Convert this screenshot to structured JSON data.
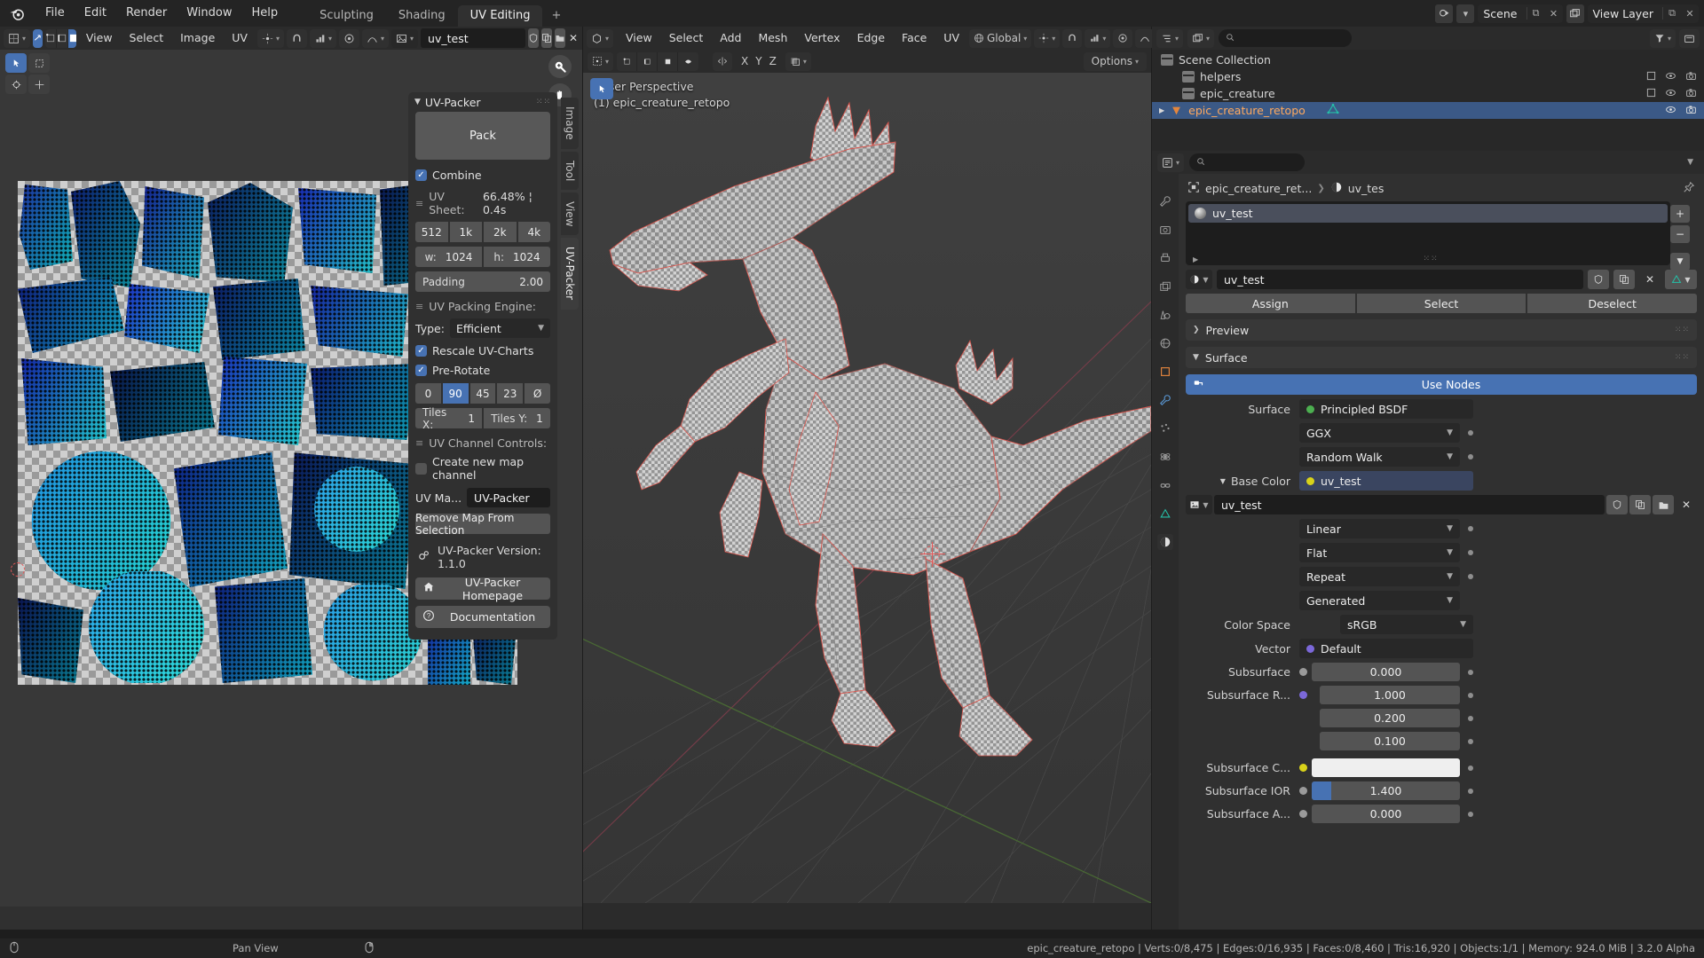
{
  "topbar": {
    "logo_icon": "blender-logo",
    "menus": [
      "File",
      "Edit",
      "Render",
      "Window",
      "Help"
    ],
    "workspaces": [
      {
        "label": "Sculpting",
        "active": false
      },
      {
        "label": "Shading",
        "active": false
      },
      {
        "label": "UV Editing",
        "active": true
      }
    ],
    "add_workspace_label": "+",
    "scene_name": "Scene",
    "view_layer_name": "View Layer",
    "scene_icon": "scene-icon",
    "viewlayer_icon": "images-icon",
    "new_scene_icon": "new-scene-icon",
    "unlink_scene_icon": "unlink-icon",
    "new_viewlayer_icon": "new-layer-icon",
    "remove_viewlayer_icon": "remove-layer-icon"
  },
  "uv_editor": {
    "header": {
      "editor_type_icon": "uv-editor-icon",
      "mode_icon": "uv-sync-icon",
      "select_modes": [
        "vertex-select-icon",
        "edge-select-icon",
        "face-select-icon"
      ],
      "menus": [
        "View",
        "Select",
        "Image",
        "UV"
      ],
      "pivot_icon": "pivot-icon",
      "snap_icon": "magnet-icon",
      "snap_target_icon": "snap-target-icon",
      "proportional_icon": "proportional-edit-icon",
      "falloff_icon": "falloff-icon",
      "image_icon": "image-datablock-icon",
      "image_name": "uv_test",
      "fake_user_icon": "shield-icon",
      "new_image_icon": "duplicate-icon",
      "open_image_icon": "folder-icon",
      "unlink_image_icon": "close-icon"
    },
    "toolbar_tools": [
      "tweak-tool-icon",
      "select-box-icon",
      "cursor-tool-icon",
      "move-tool-icon",
      "rotate-tool-icon",
      "scale-tool-icon"
    ],
    "gizmos": [
      "zoom-gizmo-icon",
      "pan-gizmo-icon"
    ],
    "vertical_tabs": [
      {
        "label": "Image",
        "active": false
      },
      {
        "label": "Tool",
        "active": false
      },
      {
        "label": "View",
        "active": false
      },
      {
        "label": "UV-Packer",
        "active": true
      }
    ]
  },
  "uv_packer": {
    "title": "UV-Packer",
    "collapse_icon": "chevron-down-icon",
    "drag_dots_icon": "grip-dots-icon",
    "pack_button": "Pack",
    "combine": {
      "label": "Combine",
      "checked": true
    },
    "uv_sheet": {
      "label": "UV Sheet:",
      "grip_icon": "grip-icon",
      "status": "66.48% ¦ 0.4s",
      "presets": [
        {
          "label": "512",
          "selected": false
        },
        {
          "label": "1k",
          "selected": false
        },
        {
          "label": "2k",
          "selected": false
        },
        {
          "label": "4k",
          "selected": false
        }
      ],
      "width_label": "w:",
      "width_value": "1024",
      "height_label": "h:",
      "height_value": "1024",
      "padding_label": "Padding",
      "padding_value": "2.00"
    },
    "engine": {
      "label": "UV Packing Engine:",
      "grip_icon": "grip-icon",
      "type_label": "Type:",
      "type_value": "Efficient",
      "type_chevron_icon": "chevron-down-icon",
      "rescale": {
        "label": "Rescale UV-Charts",
        "checked": true
      },
      "prerotate": {
        "label": "Pre-Rotate",
        "checked": true
      },
      "rotation_steps": [
        {
          "label": "0",
          "selected": false
        },
        {
          "label": "90",
          "selected": true
        },
        {
          "label": "45",
          "selected": false
        },
        {
          "label": "23",
          "selected": false
        },
        {
          "label": "Ø",
          "selected": false
        }
      ],
      "tiles_x_label": "Tiles X:",
      "tiles_x_value": "1",
      "tiles_y_label": "Tiles Y:",
      "tiles_y_value": "1"
    },
    "channel": {
      "label": "UV Channel Controls:",
      "grip_icon": "grip-icon",
      "create_new": {
        "label": "Create new map channel",
        "checked": false
      },
      "uv_map_label": "UV Ma...",
      "uv_map_value": "UV-Packer",
      "remove_map_button": "Remove Map From Selection"
    },
    "footer": {
      "version_icon": "gears-icon",
      "version_text": "UV-Packer Version: 1.1.0",
      "homepage_icon": "home-icon",
      "homepage_label": "UV-Packer Homepage",
      "docs_icon": "question-icon",
      "docs_label": "Documentation"
    }
  },
  "viewport": {
    "header": {
      "editor_type_icon": "3d-viewport-icon",
      "mode_icon": "edit-mode-icon",
      "select_modes": [
        "vertex-select-icon",
        "edge-select-icon",
        "face-select-icon"
      ],
      "menus": [
        "View",
        "Select",
        "Add",
        "Mesh",
        "Vertex",
        "Edge",
        "Face",
        "UV"
      ],
      "transform_orientation_icon": "globe-icon",
      "transform_orientation": "Global",
      "pivot_icon": "pivot-icon",
      "snap_icon": "magnet-icon",
      "snap_target_icon": "snap-target-icon",
      "proportional_icon": "proportional-edit-icon",
      "falloff_icon": "falloff-icon",
      "visibility_icon": "eye-icon",
      "shading_icons": [
        "wireframe-shading-icon",
        "solid-shading-icon",
        "material-shading-icon",
        "rendered-shading-icon"
      ]
    },
    "subheader": {
      "uv_select_icon": "uv-select-icon",
      "uv_modes": [
        "vertex-uv-icon",
        "edge-uv-icon",
        "face-uv-icon",
        "island-uv-icon"
      ],
      "mirror_icon": "mirror-icon",
      "axis_labels": [
        "X",
        "Y",
        "Z"
      ],
      "xray_icon": "xray-icon",
      "options_label": "Options",
      "options_chevron_icon": "chevron-down-icon"
    },
    "overlay_text_line1": "User Perspective",
    "overlay_text_line2": "(1) epic_creature_retopo",
    "collapse_arrow_icon": "chevron-right-icon",
    "tools": [
      "tweak-tool-icon",
      "select-box-icon",
      "cursor-tool-icon",
      "move-tool-icon",
      "rotate-tool-icon",
      "scale-tool-icon",
      "transform-tool-icon",
      "annotate-tool-icon",
      "measure-tool-icon",
      "extrude-tool-icon"
    ]
  },
  "outliner": {
    "header": {
      "editor_type_icon": "outliner-icon",
      "display_mode_icon": "view-layer-icon",
      "search_placeholder": "",
      "search_icon": "search-icon",
      "filter_icon": "filter-icon",
      "new_collection_icon": "new-collection-icon"
    },
    "root": {
      "label": "Scene Collection",
      "icon": "collection-icon"
    },
    "rows": [
      {
        "label": "helpers",
        "icon": "collection-icon",
        "selected": false,
        "checkbox": true,
        "eye_icon": "eye-icon",
        "camera_icon": "camera-icon"
      },
      {
        "label": "epic_creature",
        "icon": "collection-icon",
        "selected": false,
        "checkbox": true,
        "eye_icon": "eye-icon",
        "camera_icon": "camera-icon"
      },
      {
        "label": "epic_creature_retopo",
        "icon": "mesh-object-icon",
        "selected": true,
        "checkbox": false,
        "data_icon": "mesh-data-icon",
        "eye_icon": "eye-icon",
        "camera_icon": "camera-icon",
        "expand_icon": "chevron-right-icon"
      }
    ]
  },
  "properties": {
    "header": {
      "editor_type_icon": "properties-icon",
      "search_icon": "search-icon",
      "search_placeholder": "",
      "options_icon": "chevron-down-icon"
    },
    "tabs": [
      {
        "name": "tool-tab",
        "icon": "wrench-icon",
        "active": false
      },
      {
        "name": "render-tab",
        "icon": "camera-back-icon",
        "active": false
      },
      {
        "name": "output-tab",
        "icon": "printer-icon",
        "active": false
      },
      {
        "name": "viewlayer-tab",
        "icon": "images-icon",
        "active": false
      },
      {
        "name": "scene-tab",
        "icon": "cone-sphere-icon",
        "active": false
      },
      {
        "name": "world-tab",
        "icon": "world-icon",
        "active": false
      },
      {
        "name": "object-tab",
        "icon": "square-orange-icon",
        "active": false
      },
      {
        "name": "modifier-tab",
        "icon": "wrench-blue-icon",
        "active": false
      },
      {
        "name": "particles-tab",
        "icon": "particles-icon",
        "active": false
      },
      {
        "name": "physics-tab",
        "icon": "physics-icon",
        "active": false
      },
      {
        "name": "constraints-tab",
        "icon": "constraint-icon",
        "active": false
      },
      {
        "name": "data-tab",
        "icon": "mesh-data-icon",
        "active": false
      },
      {
        "name": "material-tab",
        "icon": "material-sphere-icon",
        "active": true
      }
    ],
    "breadcrumb": {
      "object_icon": "object-icon",
      "object_name": "epic_creature_ret...",
      "separator_icon": "chevron-right-icon",
      "material_icon": "material-sphere-icon",
      "material_name": "uv_tes",
      "pin_icon": "pin-icon"
    },
    "material_slots": [
      {
        "label": "uv_test",
        "selected": true,
        "icon": "material-sphere-icon"
      }
    ],
    "slot_buttons": {
      "add_icon": "plus-icon",
      "remove_icon": "minus-icon",
      "menu_icon": "chevron-down-icon",
      "expand_icon": "play-icon",
      "grip_icon": "grip-dots-icon"
    },
    "material_field": {
      "browse_icon": "material-sphere-icon",
      "browse_chevron_icon": "chevron-down-icon",
      "name": "uv_test",
      "fake_user_icon": "shield-icon",
      "copy_icon": "duplicate-icon",
      "unlink_icon": "close-icon",
      "mesh_icon": "mesh-data-icon",
      "mesh_chevron_icon": "chevron-down-icon"
    },
    "assign_row": [
      {
        "label": "Assign"
      },
      {
        "label": "Select"
      },
      {
        "label": "Deselect"
      }
    ],
    "preview_panel": {
      "label": "Preview",
      "expanded": false,
      "chevron_icon": "chevron-right-icon",
      "dots_icon": "grip-dots-icon"
    },
    "surface_panel": {
      "label": "Surface",
      "expanded": true,
      "chevron_icon": "chevron-down-icon",
      "dots_icon": "grip-dots-icon"
    },
    "use_nodes": {
      "label": "Use Nodes",
      "icon": "nodetree-icon"
    },
    "fields": [
      {
        "label": "Surface",
        "type": "node",
        "value": "Principled BSDF",
        "dot_color": "#4caf50",
        "has_anim_dot": false,
        "has_chevron": false
      },
      {
        "label": "",
        "type": "dropdown",
        "value": "GGX",
        "has_anim_dot": true,
        "has_chevron": true
      },
      {
        "label": "",
        "type": "dropdown",
        "value": "Random Walk",
        "has_anim_dot": true,
        "has_chevron": true
      },
      {
        "label": "Base Color",
        "type": "linked",
        "value": "uv_test",
        "dot_color": "#d8d21a",
        "expand_icon": "triangle-down-icon",
        "has_anim_dot": false,
        "has_chevron": false
      }
    ],
    "texture_row": {
      "image_icon": "image-icon",
      "chevron_icon": "chevron-down-icon",
      "name": "uv_test",
      "fake_user_icon": "shield-icon",
      "copy_icon": "duplicate-icon",
      "open_icon": "folder-icon",
      "unlink_icon": "close-icon"
    },
    "tex_dropdowns": [
      {
        "value": "Linear",
        "has_anim_dot": true
      },
      {
        "value": "Flat",
        "has_anim_dot": true
      },
      {
        "value": "Repeat",
        "has_anim_dot": true
      },
      {
        "value": "Generated",
        "has_anim_dot": false
      }
    ],
    "color_space": {
      "label": "Color Space",
      "value": "sRGB",
      "chevron_icon": "chevron-down-icon"
    },
    "vector": {
      "label": "Vector",
      "value": "Default",
      "dot_color": "#7b68d9"
    },
    "sliders": [
      {
        "label": "Subsurface",
        "value": "0.000",
        "fill": 0,
        "dot_color": "#9a9a9a",
        "has_anim_dot": true
      },
      {
        "label": "Subsurface R...",
        "value": "1.000",
        "fill": 0,
        "dot_color": "#7b68d9",
        "has_anim_dot": true,
        "indented": true
      },
      {
        "label": "",
        "value": "0.200",
        "fill": 0,
        "has_anim_dot": true,
        "indented": true
      },
      {
        "label": "",
        "value": "0.100",
        "fill": 0,
        "has_anim_dot": true,
        "indented": true
      }
    ],
    "subsurface_color": {
      "label": "Subsurface C...",
      "dot_color": "#d8d21a",
      "swatch": "#efefef",
      "has_anim_dot": true
    },
    "subsurface_ior": {
      "label": "Subsurface IOR",
      "value": "1.400",
      "fill": 13,
      "dot_color": "#9a9a9a",
      "has_anim_dot": true
    },
    "subsurface_a": {
      "label": "Subsurface A...",
      "value": "0.000",
      "fill": 0,
      "dot_color": "#9a9a9a",
      "has_anim_dot": true
    }
  },
  "statusbar": {
    "mouse_icon": "mouse-icon",
    "hint_label": "Pan View",
    "keymap_icon": "keymap-icon",
    "stats": "epic_creature_retopo | Verts:0/8,475 | Edges:0/16,935 | Faces:0/8,460 | Tris:16,920 | Objects:1/1 | Memory: 924.0 MiB | 3.2.0 Alpha"
  },
  "colors": {
    "accent_blue": "#4772b3",
    "select_orange": "#ffa95e",
    "panel_bg": "#303030",
    "dark_bg": "#1d1d1d",
    "header_bg": "#2b2b2b",
    "seam_red": "#d9544c"
  }
}
